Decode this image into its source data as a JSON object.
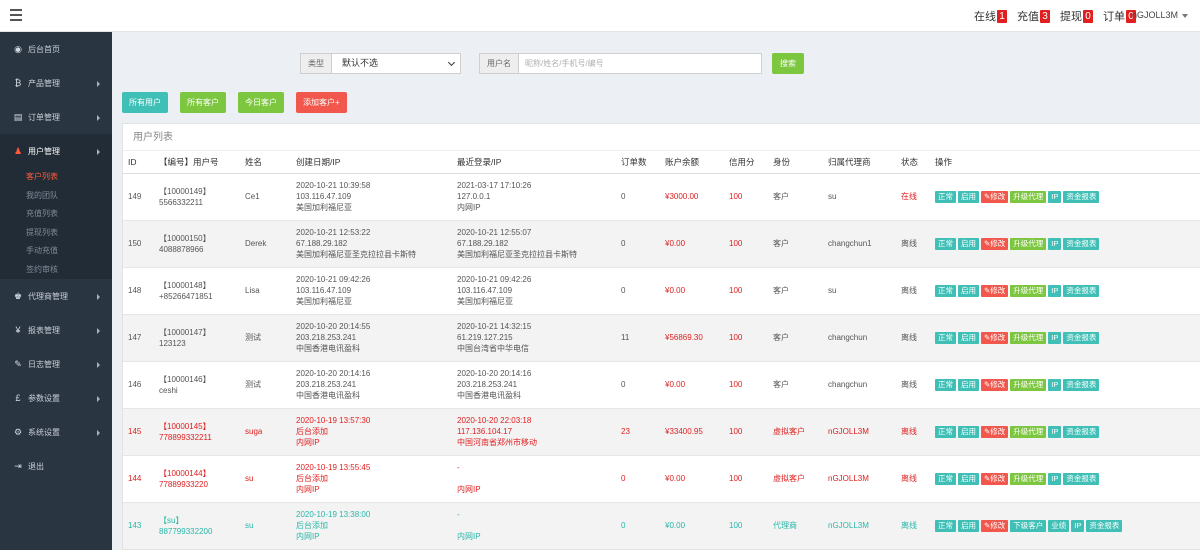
{
  "topbar": {
    "counters": [
      {
        "label": "在线",
        "count": "1"
      },
      {
        "label": "充值",
        "count": "3"
      },
      {
        "label": "提现",
        "count": "0"
      },
      {
        "label": "订单",
        "count": "0"
      }
    ],
    "user": "nGJOLL3M"
  },
  "sidebar": {
    "items": [
      {
        "label": "后台首页",
        "icon": "dashboard-icon",
        "glyph": "◉",
        "arrow": false
      },
      {
        "label": "产品管理",
        "icon": "bitcoin-icon",
        "glyph": "₿",
        "arrow": true
      },
      {
        "label": "订单管理",
        "icon": "clipboard-icon",
        "glyph": "▤",
        "arrow": true
      },
      {
        "label": "用户管理",
        "icon": "user-icon",
        "glyph": "♟",
        "arrow": true,
        "active": true
      },
      {
        "label": "代理商管理",
        "icon": "users-icon",
        "glyph": "♚",
        "arrow": true
      },
      {
        "label": "报表管理",
        "icon": "yen-icon",
        "glyph": "¥",
        "arrow": true
      },
      {
        "label": "日志管理",
        "icon": "pencil-icon",
        "glyph": "✎",
        "arrow": true
      },
      {
        "label": "参数设置",
        "icon": "pound-icon",
        "glyph": "£",
        "arrow": true
      },
      {
        "label": "系统设置",
        "icon": "gears-icon",
        "glyph": "⚙",
        "arrow": true
      },
      {
        "label": "退出",
        "icon": "logout-icon",
        "glyph": "⇥",
        "arrow": false
      }
    ],
    "subitems": [
      "客户列表",
      "我的团队",
      "充值列表",
      "提现列表",
      "手动充值",
      "签约审核"
    ]
  },
  "search": {
    "type_label": "类型",
    "type_value": "默认不选",
    "username_label": "用户名",
    "username_placeholder": "昵称/姓名/手机号/编号",
    "search_button": "搜索"
  },
  "actions": {
    "all_users": "所有用户",
    "all_customers": "所有客户",
    "today_customers": "今日客户",
    "add_customer": "添加客户+"
  },
  "panel": {
    "title": "用户列表",
    "headers": [
      "ID",
      "【编号】用户号",
      "姓名",
      "创建日期/IP",
      "最近登录/IP",
      "订单数",
      "账户余额",
      "信用分",
      "身份",
      "归属代理商",
      "状态",
      "操作"
    ]
  },
  "rows": [
    {
      "id": "149",
      "code": "【10000149】",
      "phone": "5566332211",
      "name": "Ce1",
      "created_date": "2020-10-21 10:39:58",
      "created_ip": "103.116.47.109",
      "created_loc": "美国加利福尼亚",
      "login_date": "2021-03-17 17:10:26",
      "login_ip": "127.0.0.1",
      "login_loc": "内网IP",
      "orders": "0",
      "balance": "¥3000.00",
      "credit": "100",
      "role": "客户",
      "agent": "su",
      "status": "在线",
      "ops": [
        "正常",
        "启用",
        "✎修改",
        "升级代理",
        "IP",
        "资金报表"
      ]
    },
    {
      "id": "150",
      "code": "【10000150】",
      "phone": "4088878966",
      "name": "Derek",
      "created_date": "2020-10-21 12:53:22",
      "created_ip": "67.188.29.182",
      "created_loc": "美国加利福尼亚圣克拉拉县卡斯特",
      "login_date": "2020-10-21 12:55:07",
      "login_ip": "67.188.29.182",
      "login_loc": "美国加利福尼亚圣克拉拉县卡斯特",
      "orders": "0",
      "balance": "¥0.00",
      "credit": "100",
      "role": "客户",
      "agent": "changchun1",
      "status": "离线",
      "ops": [
        "正常",
        "启用",
        "✎修改",
        "升级代理",
        "IP",
        "资金报表"
      ]
    },
    {
      "id": "148",
      "code": "【10000148】",
      "phone": "+85266471851",
      "name": "Lisa",
      "created_date": "2020-10-21 09:42:26",
      "created_ip": "103.116.47.109",
      "created_loc": "美国加利福尼亚",
      "login_date": "2020-10-21 09:42:26",
      "login_ip": "103.116.47.109",
      "login_loc": "美国加利福尼亚",
      "orders": "0",
      "balance": "¥0.00",
      "credit": "100",
      "role": "客户",
      "agent": "su",
      "status": "离线",
      "ops": [
        "正常",
        "启用",
        "✎修改",
        "升级代理",
        "IP",
        "资金报表"
      ]
    },
    {
      "id": "147",
      "code": "【10000147】",
      "phone": "123123",
      "name": "测试",
      "created_date": "2020-10-20 20:14:55",
      "created_ip": "203.218.253.241",
      "created_loc": "中国香港电讯盈科",
      "login_date": "2020-10-21 14:32:15",
      "login_ip": "61.219.127.215",
      "login_loc": "中国台湾省中华电信",
      "orders": "11",
      "balance": "¥56869.30",
      "credit": "100",
      "role": "客户",
      "agent": "changchun",
      "status": "离线",
      "ops": [
        "正常",
        "启用",
        "✎修改",
        "升级代理",
        "IP",
        "资金报表"
      ]
    },
    {
      "id": "146",
      "code": "【10000146】",
      "phone": "ceshi",
      "name": "测试",
      "created_date": "2020-10-20 20:14:16",
      "created_ip": "203.218.253.241",
      "created_loc": "中国香港电讯盈科",
      "login_date": "2020-10-20 20:14:16",
      "login_ip": "203.218.253.241",
      "login_loc": "中国香港电讯盈科",
      "orders": "0",
      "balance": "¥0.00",
      "credit": "100",
      "role": "客户",
      "agent": "changchun",
      "status": "离线",
      "ops": [
        "正常",
        "启用",
        "✎修改",
        "升级代理",
        "IP",
        "资金报表"
      ]
    },
    {
      "id": "145",
      "code": "【10000145】",
      "phone": "778899332211",
      "name": "suga",
      "created_date": "2020-10-19 13:57:30",
      "created_ip": "后台添加",
      "created_loc": "内网IP",
      "login_date": "2020-10-20 22:03:18",
      "login_ip": "117.136.104.17",
      "login_loc": "中国河南省郑州市移动",
      "orders": "23",
      "balance": "¥33400.95",
      "credit": "100",
      "role": "虚拟客户",
      "agent": "nGJOLL3M",
      "status": "离线",
      "ops": [
        "正常",
        "启用",
        "✎修改",
        "升级代理",
        "IP",
        "资金报表"
      ]
    },
    {
      "id": "144",
      "code": "【10000144】",
      "phone": "77889933220",
      "name": "su",
      "created_date": "2020-10-19 13:55:45",
      "created_ip": "后台添加",
      "created_loc": "内网IP",
      "login_date": "-",
      "login_ip": "",
      "login_loc": "内网IP",
      "orders": "0",
      "balance": "¥0.00",
      "credit": "100",
      "role": "虚拟客户",
      "agent": "nGJOLL3M",
      "status": "离线",
      "ops": [
        "正常",
        "启用",
        "✎修改",
        "升级代理",
        "IP",
        "资金报表"
      ]
    },
    {
      "id": "143",
      "code": "【su】",
      "phone": "887799332200",
      "name": "su",
      "created_date": "2020-10-19 13:38:00",
      "created_ip": "后台添加",
      "created_loc": "内网IP",
      "login_date": "-",
      "login_ip": "",
      "login_loc": "内网IP",
      "orders": "0",
      "balance": "¥0.00",
      "credit": "100",
      "role": "代理商",
      "agent": "nGJOLL3M",
      "status": "离线",
      "ops": [
        "正常",
        "启用",
        "✎修改",
        "下级客户",
        "业绩",
        "IP",
        "资金报表"
      ]
    }
  ]
}
